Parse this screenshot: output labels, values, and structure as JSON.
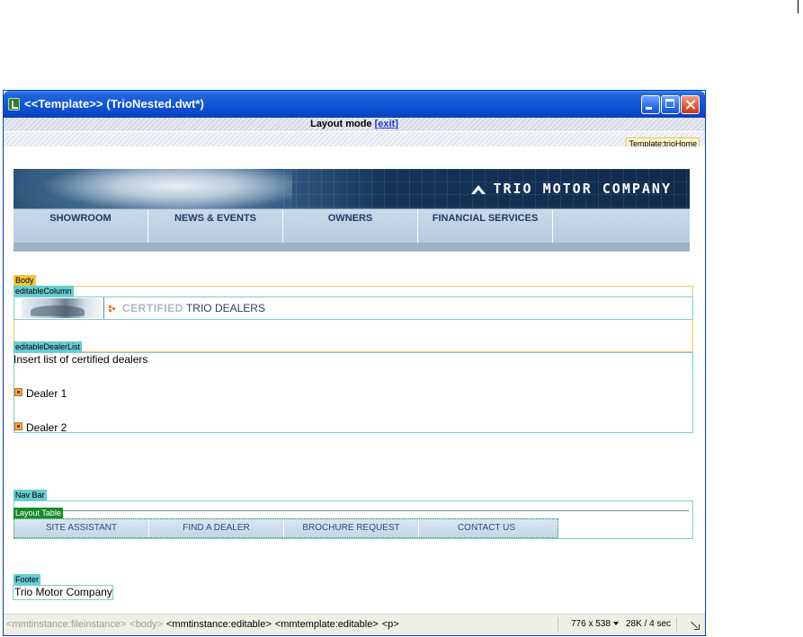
{
  "window": {
    "title": "<<Template>>  (TrioNested.dwt*)"
  },
  "layout_bar": {
    "label": "Layout mode ",
    "exit_label": "[exit]"
  },
  "template_tag": "Template:trioHome",
  "banner": {
    "brand": "TRIO MOTOR COMPANY",
    "brand_logo_icon": "trio-chevron-logo-icon"
  },
  "top_nav": {
    "items": [
      "SHOWROOM",
      "NEWS & EVENTS",
      "OWNERS",
      "FINANCIAL SERVICES",
      ""
    ]
  },
  "regions": {
    "body": "Body",
    "editable_column": "editableColumn",
    "editable_dealer_list": "editableDealerList",
    "nav_bar": "Nav Bar",
    "layout_table": "Layout Table",
    "footer": "Footer"
  },
  "certified": {
    "title_highlight": "CERTIFIED",
    "title_rest": " TRIO DEALERS"
  },
  "dealer_list": {
    "intro": "Insert list of certified dealers",
    "dealers": [
      "Dealer 1",
      "Dealer 2"
    ]
  },
  "sub_nav": {
    "items": [
      "SITE ASSISTANT",
      "FIND A DEALER",
      "BROCHURE REQUEST",
      "CONTACT US"
    ]
  },
  "footer": {
    "text": "Trio Motor Company"
  },
  "status_bar": {
    "tags": [
      {
        "label": "<mmtinstance:fileinstance>",
        "state": "dim"
      },
      {
        "label": "<body>",
        "state": "dim"
      },
      {
        "label": "<mmtinstance:editable>",
        "state": "active"
      },
      {
        "label": "<mmtemplate:editable>",
        "state": "active"
      },
      {
        "label": "<p>",
        "state": "active"
      }
    ],
    "window_size": "776 x 538",
    "download_stats": "28K / 4 sec"
  },
  "colors": {
    "titlebar_blue": "#0a48cc",
    "body_region": "#f5c53f",
    "editable_region": "#66ccd0",
    "layout_table": "#178c2a",
    "nav_text": "#1e3a66",
    "link_blue": "#1a36d8"
  }
}
